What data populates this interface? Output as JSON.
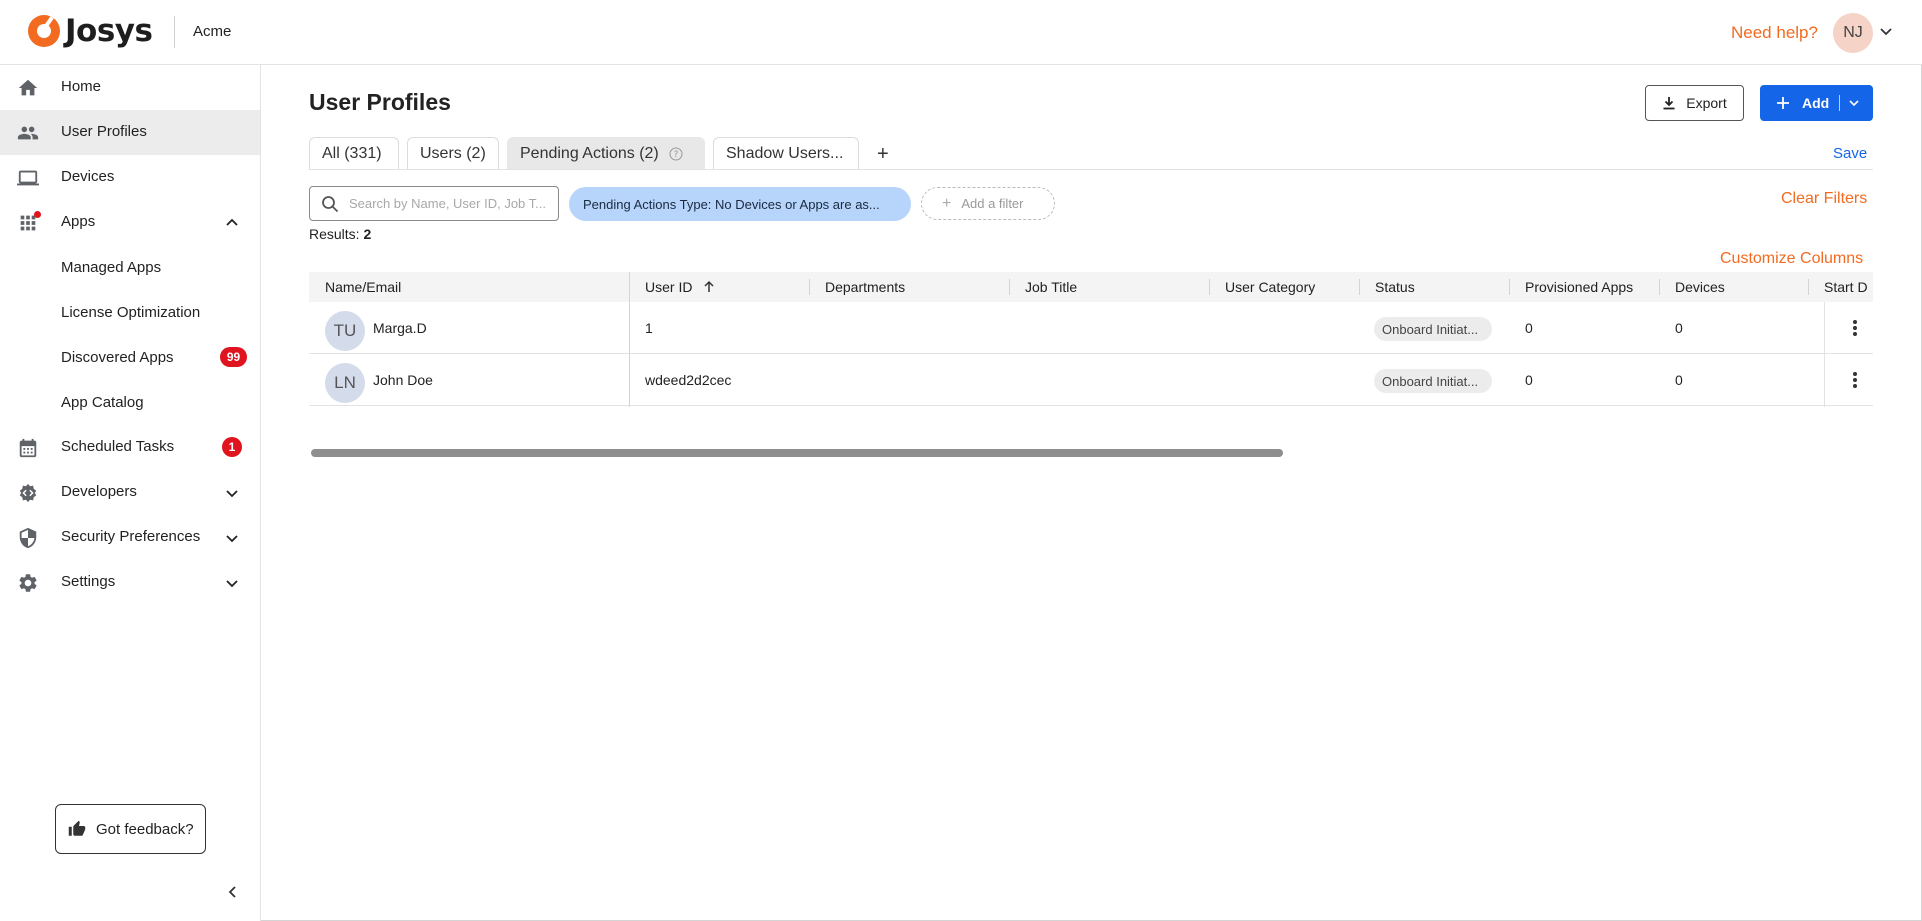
{
  "app": {
    "brand": "Josys",
    "org": "Acme"
  },
  "header": {
    "help": "Need help?",
    "user_initials": "NJ"
  },
  "sidebar": {
    "home": "Home",
    "user_profiles": "User Profiles",
    "devices": "Devices",
    "apps": "Apps",
    "managed_apps": "Managed Apps",
    "license_optimization": "License Optimization",
    "discovered_apps": "Discovered Apps",
    "discovered_badge": "99",
    "app_catalog": "App Catalog",
    "scheduled_tasks": "Scheduled Tasks",
    "scheduled_badge": "1",
    "developers": "Developers",
    "security_preferences": "Security Preferences",
    "settings": "Settings",
    "feedback": "Got feedback?"
  },
  "page": {
    "title": "User Profiles",
    "export": "Export",
    "add": "Add",
    "tabs": [
      {
        "label": "All (331)"
      },
      {
        "label": "Users (2)"
      },
      {
        "label": "Pending Actions (2)"
      },
      {
        "label": "Shadow Users..."
      }
    ],
    "tab_add": "+",
    "save": "Save",
    "search_placeholder": "Search by Name, User ID, Job T...",
    "filter_chip": "Pending Actions Type: No Devices or Apps are as...",
    "add_filter": "Add a filter",
    "clear_filters": "Clear Filters",
    "results_label": "Results:",
    "results_count": "2",
    "customize_columns": "Customize Columns"
  },
  "table": {
    "columns": [
      "Name/Email",
      "User ID",
      "Departments",
      "Job Title",
      "User Category",
      "Status",
      "Provisioned Apps",
      "Devices",
      "Start D"
    ],
    "rows": [
      {
        "initials": "TU",
        "name": "Marga.D",
        "user_id": "1",
        "department": "",
        "job_title": "",
        "category": "",
        "status": "Onboard Initiat...",
        "provisioned_apps": "0",
        "devices": "0"
      },
      {
        "initials": "LN",
        "name": "John Doe",
        "user_id": "wdeed2d2cec",
        "department": "",
        "job_title": "",
        "category": "",
        "status": "Onboard Initiat...",
        "provisioned_apps": "0",
        "devices": "0"
      }
    ]
  },
  "colors": {
    "accent": "#f26b21",
    "primary": "#1565e8",
    "badge": "#e0141e",
    "chip": "#b7d4fb"
  }
}
